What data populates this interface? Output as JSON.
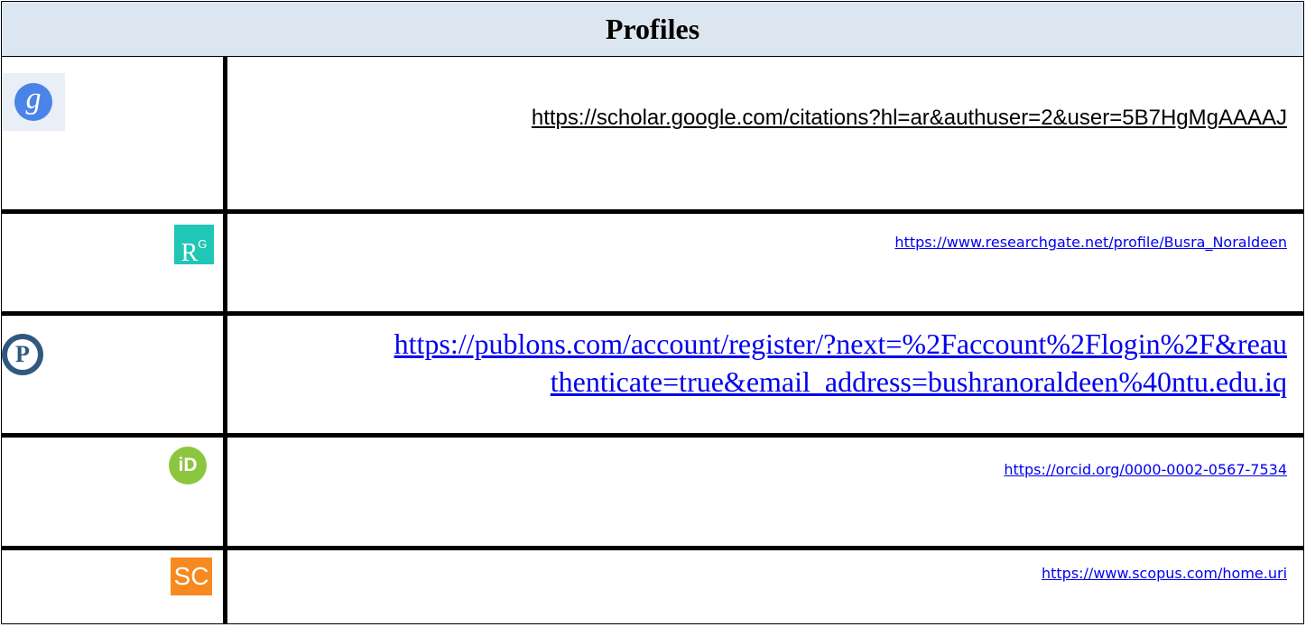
{
  "header": {
    "title": "Profiles"
  },
  "profiles": [
    {
      "icon": "google-scholar-icon",
      "icon_text": "g",
      "url": "https://scholar.google.com/citations?hl=ar&authuser=2&user=5B7HgMgAAAAJ"
    },
    {
      "icon": "researchgate-icon",
      "icon_text": "R",
      "icon_sup": "G",
      "url": "https://www.researchgate.net/profile/Busra_Noraldeen"
    },
    {
      "icon": "publons-icon",
      "icon_text": "P",
      "url_line1": "https://publons.com/account/register/?next=%2Faccount%2Flogin%2F&reau",
      "url_line2": "thenticate=true&email_address=bushranoraldeen%40ntu.edu.iq"
    },
    {
      "icon": "orcid-icon",
      "icon_text": "iD",
      "url": "https://orcid.org/0000-0002-0567-7534"
    },
    {
      "icon": "scopus-icon",
      "icon_text": "SC",
      "url": "https://www.scopus.com/home.uri"
    }
  ],
  "colors": {
    "header_bg": "#dce6f1",
    "link": "#0000ee",
    "scholar_blue": "#4a84e8",
    "researchgate_teal": "#20c6b6",
    "publons_navy": "#31587f",
    "orcid_green": "#8cc63f",
    "scopus_orange": "#f6891f"
  }
}
